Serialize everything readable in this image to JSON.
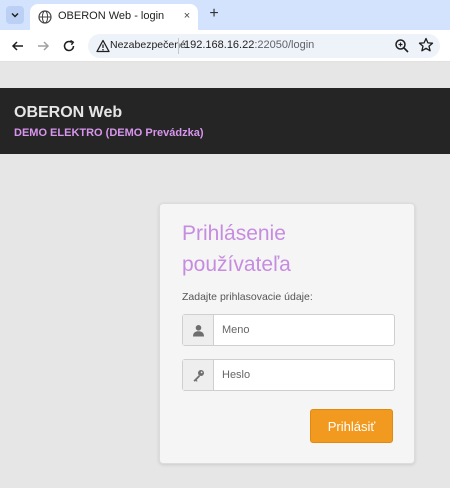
{
  "browser": {
    "tab_title": "OBERON Web - login",
    "tab_close": "×",
    "new_tab": "+",
    "security_label": "Nezabezpečené",
    "url_host": "192.168.16.22",
    "url_path": ":22050/login"
  },
  "header": {
    "title": "OBERON Web",
    "subtitle": "DEMO ELEKTRO (DEMO Prevádzka)"
  },
  "login": {
    "title": "Prihlásenie používateľa",
    "hint": "Zadajte prihlasovacie údaje:",
    "username_placeholder": "Meno",
    "password_placeholder": "Heslo",
    "submit_label": "Prihlásiť"
  },
  "colors": {
    "header_bg": "#252525",
    "subtitle": "#d895ee",
    "card_title": "#c68ce0",
    "button_bg": "#f19a1f"
  }
}
